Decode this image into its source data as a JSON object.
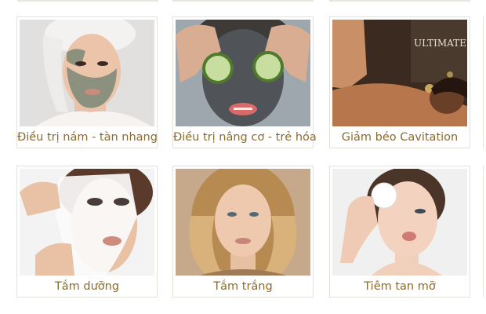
{
  "services": [
    {
      "label": "Điều trị nám - tàn nhang",
      "image": "woman-clay-mask-towel"
    },
    {
      "label": "Điều trị nâng cơ - trẻ hóa",
      "image": "woman-cucumber-eye-mask"
    },
    {
      "label": "Giảm béo Cavitation",
      "image": "woman-spa-massage",
      "overlay_text": "ULTIMATE"
    },
    {
      "label": "Tắm dưỡng",
      "image": "woman-sheet-mask"
    },
    {
      "label": "Tắm trắng",
      "image": "woman-blonde-portrait"
    },
    {
      "label": "Tiêm tan mỡ",
      "image": "woman-cotton-pad"
    }
  ],
  "colors": {
    "label_text": "#8a6b2f",
    "card_border": "#e4e0da"
  }
}
